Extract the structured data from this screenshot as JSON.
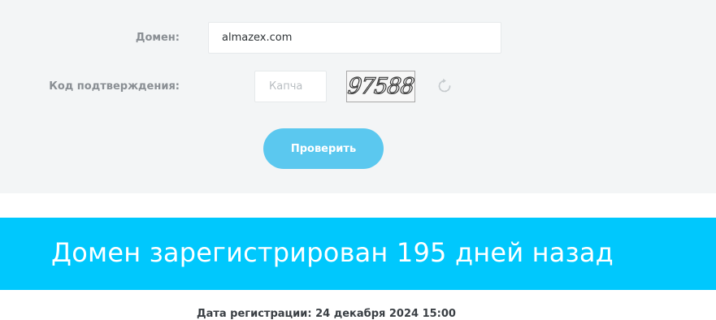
{
  "form": {
    "domain_label": "Домен:",
    "domain_value": "almazex.com",
    "captcha_label": "Код подтверждения:",
    "captcha_placeholder": "Капча",
    "captcha_image_text": "97588",
    "refresh_icon": "refresh-icon",
    "submit_label": "Проверить"
  },
  "result": {
    "title": "Домен зарегистрирован 195 дней назад",
    "registration_date": "Дата регистрации: 24 декабря 2024 15:00"
  },
  "colors": {
    "panel_background": "#f3f5f6",
    "button": "#5bc8ef",
    "banner": "#00c8fd"
  }
}
